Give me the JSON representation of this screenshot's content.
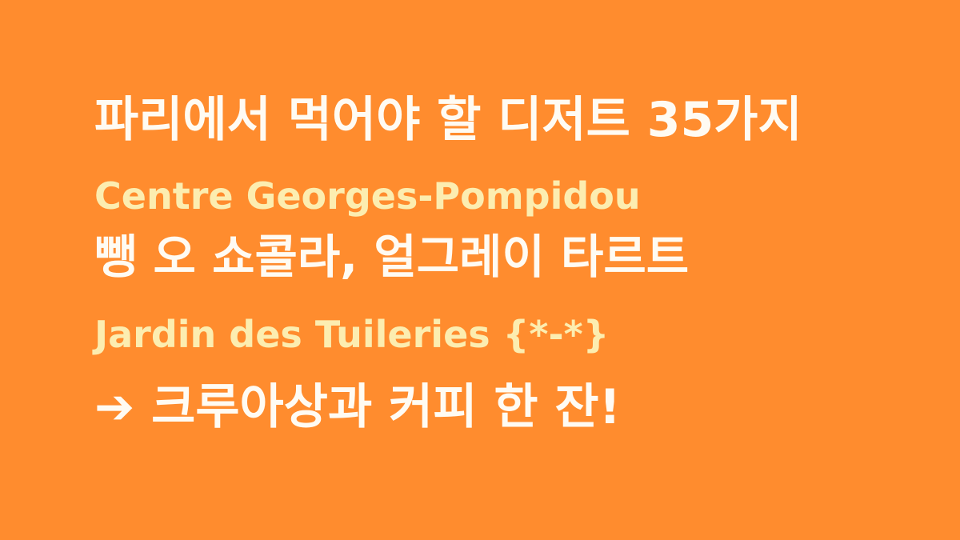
{
  "lines": [
    {
      "text": "파리에서 먹어야 할 디저트 35가지",
      "color": "#FFFBF3"
    },
    {
      "text": "Centre Georges-Pompidou",
      "color": "#FCEDB0"
    },
    {
      "text": "뺑 오 쇼콜라, 얼그레이 타르트",
      "color": "#FFFBF3"
    },
    {
      "text": "Jardin des Tuileries {*-*}",
      "color": "#FCEDB0"
    },
    {
      "text": "➔ 크루아상과 커피 한 잔!",
      "color": "#FFFBF3"
    }
  ],
  "background_color": "#FF8C2E"
}
